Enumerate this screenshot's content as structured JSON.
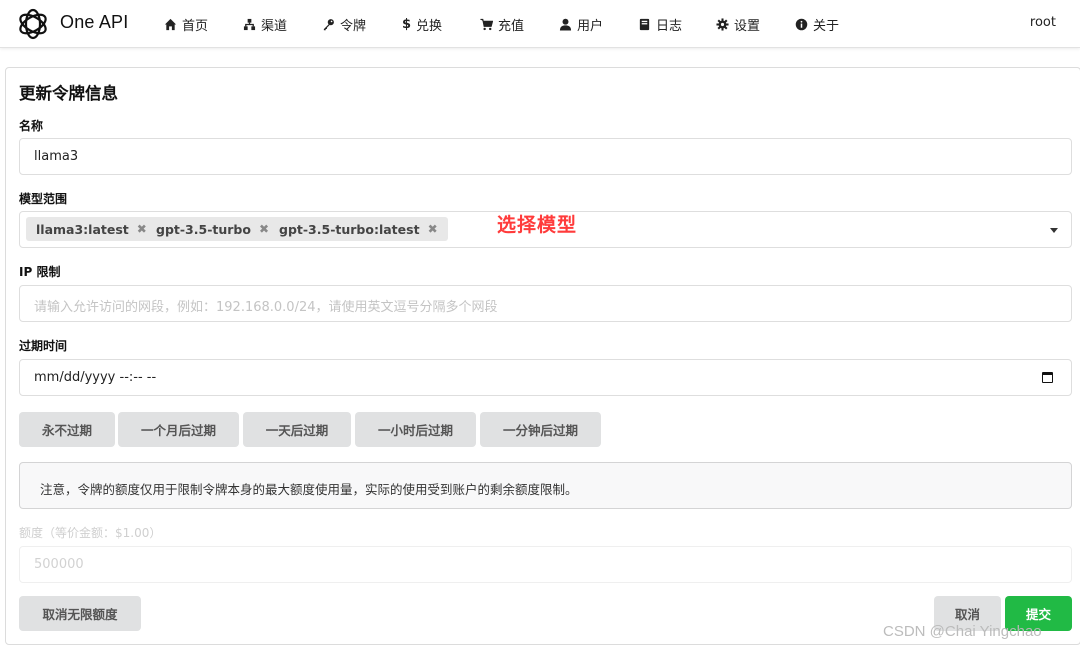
{
  "header": {
    "brand": "One API",
    "nav": [
      {
        "icon": "home-icon",
        "label": "首页"
      },
      {
        "icon": "sitemap-icon",
        "label": "渠道"
      },
      {
        "icon": "key-icon",
        "label": "令牌"
      },
      {
        "icon": "dollar-icon",
        "label": "兑换"
      },
      {
        "icon": "cart-icon",
        "label": "充值"
      },
      {
        "icon": "user-icon",
        "label": "用户"
      },
      {
        "icon": "book-icon",
        "label": "日志"
      },
      {
        "icon": "gear-icon",
        "label": "设置"
      },
      {
        "icon": "info-icon",
        "label": "关于"
      }
    ],
    "user": "root"
  },
  "form": {
    "title": "更新令牌信息",
    "name_label": "名称",
    "name_value": "llama3",
    "models_label": "模型范围",
    "models": [
      "llama3:latest",
      "gpt-3.5-turbo",
      "gpt-3.5-turbo:latest"
    ],
    "tag_remove": "✖",
    "annotation": "选择模型",
    "ip_label": "IP 限制",
    "ip_placeholder": "请输入允许访问的网段，例如：192.168.0.0/24，请使用英文逗号分隔多个网段",
    "expire_label": "过期时间",
    "expire_value": "mm/dd/yyyy --:-- --",
    "expire_buttons": [
      "永不过期",
      "一个月后过期",
      "一天后过期",
      "一小时后过期",
      "一分钟后过期"
    ],
    "notice": "注意，令牌的额度仅用于限制令牌本身的最大额度使用量，实际的使用受到账户的剩余额度限制。",
    "quota_label": "额度（等价金额：$1.00）",
    "quota_value": "500000",
    "unlimited_button": "取消无限额度",
    "cancel_button": "取消",
    "submit_button": "提交"
  },
  "watermark": "CSDN @Chai Yingchao",
  "colors": {
    "submit": "#21ba45",
    "button_gray": "#e0e1e2",
    "annotation": "#ff3b3b"
  }
}
